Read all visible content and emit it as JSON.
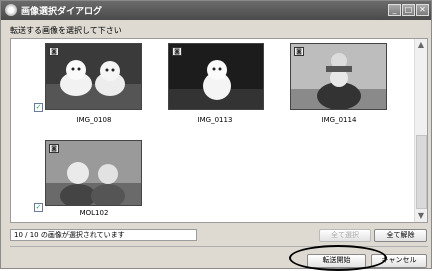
{
  "window": {
    "title": "画像選択ダイアログ"
  },
  "instruction": "転送する画像を選択して下さい",
  "images": [
    {
      "name": "IMG_0108",
      "checked": true
    },
    {
      "name": "IMG_0113",
      "checked": true
    },
    {
      "name": "IMG_0114",
      "checked": true
    },
    {
      "name": "MOL102",
      "checked": true
    }
  ],
  "status": "10 / 10 の画像が選択されています",
  "buttons": {
    "select_all": "全て選択",
    "clear_all": "全て解除",
    "start_transfer": "転送開始",
    "cancel": "キャンセル"
  },
  "colors": {
    "titlebar": "#5a5a5a",
    "dialog_bg": "#dedad2"
  }
}
